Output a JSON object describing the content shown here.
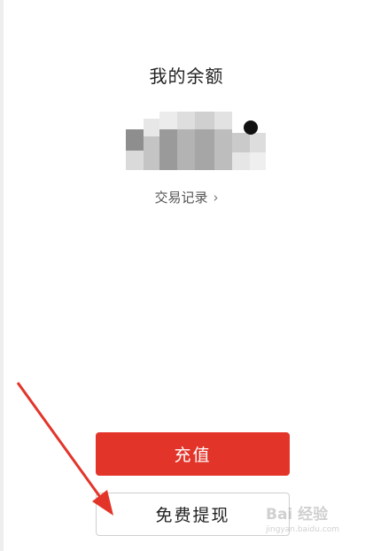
{
  "header": {
    "title": "我的余额"
  },
  "balance": {
    "hidden_value_icon": "pixelated-balance",
    "visibility_toggle_icon": "eye-dot-icon"
  },
  "transactions": {
    "link_label": "交易记录",
    "chevron": "›"
  },
  "actions": {
    "recharge_label": "充值",
    "withdraw_label": "免费提现"
  },
  "annotation": {
    "arrow_icon": "red-arrow-icon"
  },
  "colors": {
    "primary_red": "#e3342a",
    "text_dark": "#222222",
    "text_muted": "#555555"
  },
  "watermark": {
    "logo_text": "Bai 经验",
    "url_text": "jingyan.baidu.com"
  }
}
